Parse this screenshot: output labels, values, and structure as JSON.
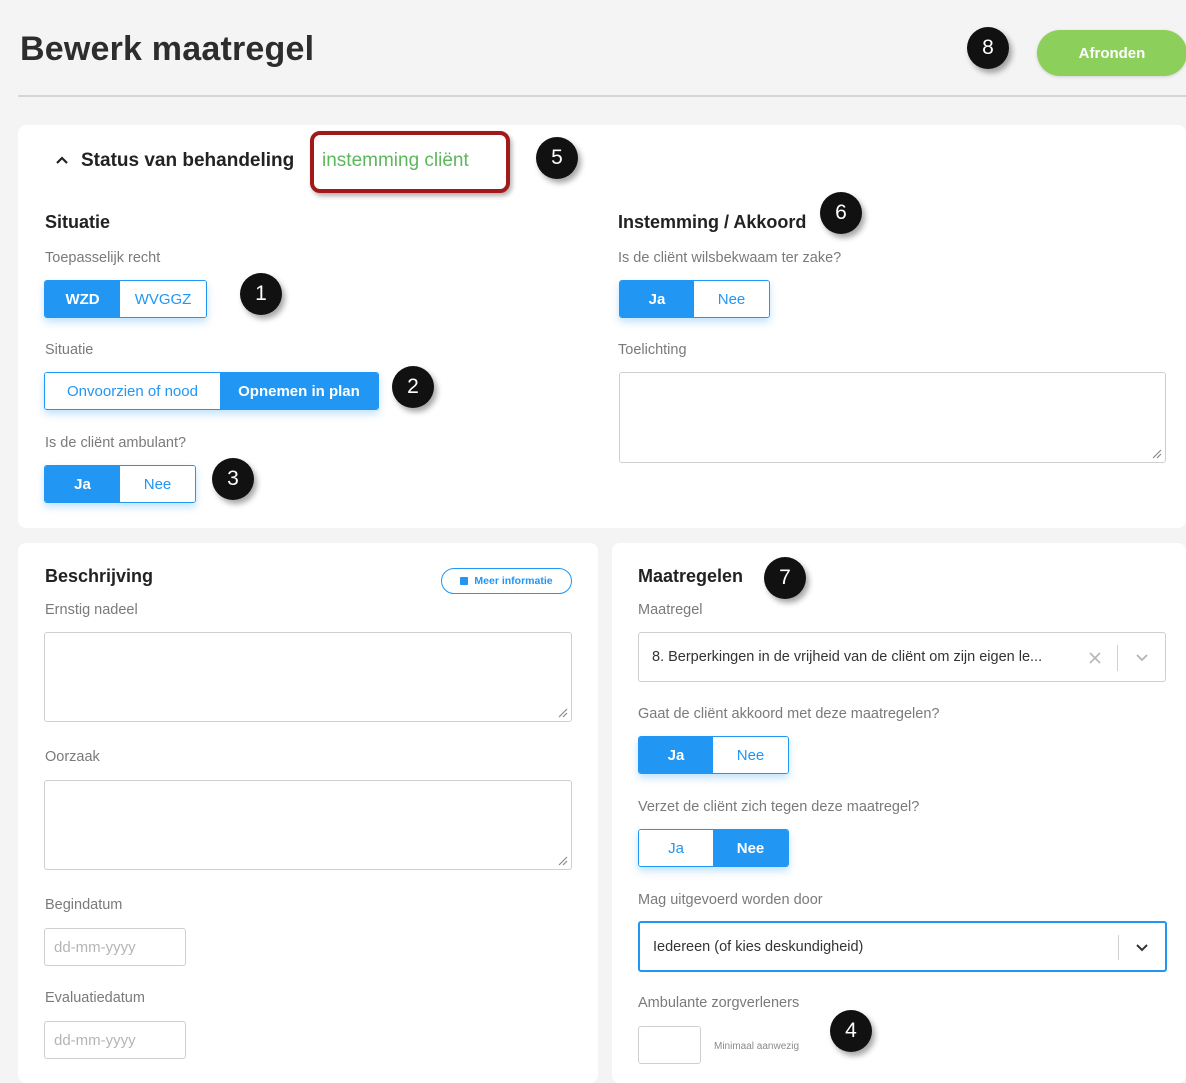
{
  "header": {
    "title": "Bewerk maatregel",
    "finish_label": "Afronden"
  },
  "status": {
    "label": "Status van behandeling",
    "value": "instemming cliënt"
  },
  "badges": [
    "1",
    "2",
    "3",
    "4",
    "5",
    "6",
    "7",
    "8"
  ],
  "situatie": {
    "heading": "Situatie",
    "recht_label": "Toepasselijk recht",
    "recht_options": [
      "WZD",
      "WVGGZ"
    ],
    "situatie_label": "Situatie",
    "situatie_options": [
      "Onvoorzien of nood",
      "Opnemen in plan"
    ],
    "ambulant_label": "Is de cliënt ambulant?",
    "ambulant_options": [
      "Ja",
      "Nee"
    ]
  },
  "instemming": {
    "heading": "Instemming / Akkoord",
    "wilsbekwaam_label": "Is de cliënt wilsbekwaam ter zake?",
    "wilsbekwaam_options": [
      "Ja",
      "Nee"
    ],
    "toelichting_label": "Toelichting"
  },
  "beschrijving": {
    "heading": "Beschrijving",
    "more_info": "Meer informatie",
    "ernstig_label": "Ernstig nadeel",
    "oorzaak_label": "Oorzaak",
    "begindatum_label": "Begindatum",
    "begindatum_placeholder": "dd-mm-yyyy",
    "evaluatie_label": "Evaluatiedatum",
    "evaluatie_placeholder": "dd-mm-yyyy"
  },
  "maatregelen": {
    "heading": "Maatregelen",
    "maatregel_label": "Maatregel",
    "maatregel_value": "8. Berperkingen in de vrijheid van de cliënt om zijn eigen le...",
    "akkoord_label": "Gaat de cliënt akkoord met deze maatregelen?",
    "akkoord_options": [
      "Ja",
      "Nee"
    ],
    "verzet_label": "Verzet de cliënt zich tegen deze maatregel?",
    "verzet_options": [
      "Ja",
      "Nee"
    ],
    "uitgevoerd_label": "Mag uitgevoerd worden door",
    "uitgevoerd_value": "Iedereen (of kies deskundigheid)",
    "ambulante_label": "Ambulante zorgverleners",
    "minimaal_label": "Minimaal aanwezig"
  },
  "colors": {
    "primary": "#2196f3",
    "accent": "#8ccf5a",
    "status": "#5cb85c",
    "highlight": "#a11a1a"
  }
}
